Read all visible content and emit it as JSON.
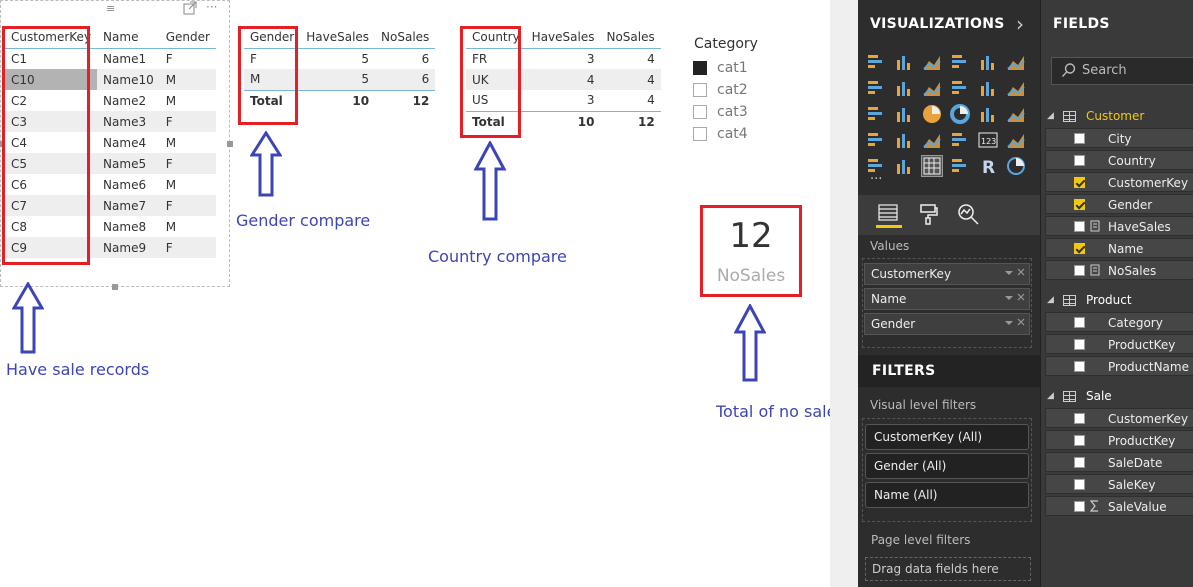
{
  "customer_table": {
    "headers": [
      "CustomerKey",
      "Name",
      "Gender"
    ],
    "rows": [
      [
        "C1",
        "Name1",
        "F"
      ],
      [
        "C10",
        "Name10",
        "M"
      ],
      [
        "C2",
        "Name2",
        "M"
      ],
      [
        "C3",
        "Name3",
        "F"
      ],
      [
        "C4",
        "Name4",
        "M"
      ],
      [
        "C5",
        "Name5",
        "F"
      ],
      [
        "C6",
        "Name6",
        "M"
      ],
      [
        "C7",
        "Name7",
        "F"
      ],
      [
        "C8",
        "Name8",
        "M"
      ],
      [
        "C9",
        "Name9",
        "F"
      ]
    ],
    "header_glyph": "≡",
    "more_glyph": "···"
  },
  "gender_table": {
    "headers": [
      "Gender",
      "HaveSales",
      "NoSales"
    ],
    "rows": [
      [
        "F",
        "5",
        "6"
      ],
      [
        "M",
        "5",
        "6"
      ]
    ],
    "total": [
      "Total",
      "10",
      "12"
    ]
  },
  "country_table": {
    "headers": [
      "Country",
      "HaveSales",
      "NoSales"
    ],
    "rows": [
      [
        "FR",
        "3",
        "4"
      ],
      [
        "UK",
        "4",
        "4"
      ],
      [
        "US",
        "3",
        "4"
      ]
    ],
    "total": [
      "Total",
      "10",
      "12"
    ]
  },
  "slicer": {
    "title": "Category",
    "items": [
      {
        "label": "cat1",
        "checked": true
      },
      {
        "label": "cat2",
        "checked": false
      },
      {
        "label": "cat3",
        "checked": false
      },
      {
        "label": "cat4",
        "checked": false
      }
    ]
  },
  "card": {
    "value": "12",
    "label": "NoSales"
  },
  "annotations": {
    "have_sale_records": "Have sale records",
    "gender_compare": "Gender compare",
    "country_compare": "Country compare",
    "total_no_sales": "Total of no sales"
  },
  "colors": {
    "accent": "#f2c811",
    "annotation_box": "#e41f26",
    "annotation_text": "#3c45b6"
  },
  "visualizations_pane": {
    "title": "VISUALIZATIONS",
    "chevron": "›",
    "more": "···",
    "values_label": "Values",
    "wells": [
      "CustomerKey",
      "Name",
      "Gender"
    ],
    "filters_title": "FILTERS",
    "visual_level_label": "Visual level filters",
    "visual_filters": [
      "CustomerKey (All)",
      "Gender (All)",
      "Name (All)"
    ],
    "page_level_label": "Page level filters",
    "drop_hint": "Drag data fields here"
  },
  "fields_pane": {
    "title": "FIELDS",
    "search_placeholder": "Search",
    "tables": [
      {
        "name": "Customer",
        "fields": [
          {
            "name": "City",
            "checked": false,
            "icon": ""
          },
          {
            "name": "Country",
            "checked": false,
            "icon": ""
          },
          {
            "name": "CustomerKey",
            "checked": true,
            "icon": ""
          },
          {
            "name": "Gender",
            "checked": true,
            "icon": ""
          },
          {
            "name": "HaveSales",
            "checked": false,
            "icon": "calc-icon"
          },
          {
            "name": "Name",
            "checked": true,
            "icon": ""
          },
          {
            "name": "NoSales",
            "checked": false,
            "icon": "calc-icon"
          }
        ]
      },
      {
        "name": "Product",
        "fields": [
          {
            "name": "Category",
            "checked": false,
            "icon": ""
          },
          {
            "name": "ProductKey",
            "checked": false,
            "icon": ""
          },
          {
            "name": "ProductName",
            "checked": false,
            "icon": ""
          }
        ]
      },
      {
        "name": "Sale",
        "fields": [
          {
            "name": "CustomerKey",
            "checked": false,
            "icon": ""
          },
          {
            "name": "ProductKey",
            "checked": false,
            "icon": ""
          },
          {
            "name": "SaleDate",
            "checked": false,
            "icon": ""
          },
          {
            "name": "SaleKey",
            "checked": false,
            "icon": ""
          },
          {
            "name": "SaleValue",
            "checked": false,
            "icon": "sigma-icon"
          }
        ]
      }
    ]
  }
}
